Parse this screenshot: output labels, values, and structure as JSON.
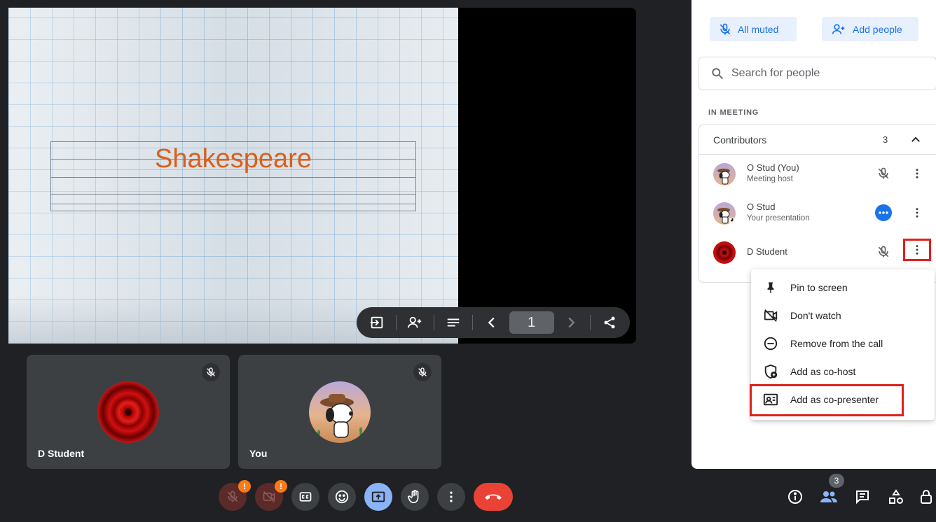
{
  "slide": {
    "title": "Shakespeare",
    "page": "1"
  },
  "tiles": [
    {
      "name": "D Student"
    },
    {
      "name": "You"
    }
  ],
  "panel": {
    "all_muted": "All muted",
    "add_people": "Add people",
    "search_placeholder": "Search for people",
    "section_label": "IN MEETING",
    "contributors_label": "Contributors",
    "contributors_count": "3",
    "people": [
      {
        "name": "O Stud (You)",
        "subtitle": "Meeting host"
      },
      {
        "name": "O Stud",
        "subtitle": "Your presentation"
      },
      {
        "name": "D Student",
        "subtitle": ""
      }
    ],
    "menu": [
      {
        "label": "Pin to screen",
        "icon": "pin-icon"
      },
      {
        "label": "Don't watch",
        "icon": "video-off-icon"
      },
      {
        "label": "Remove from the call",
        "icon": "remove-circle-icon"
      },
      {
        "label": "Add as co-host",
        "icon": "shield-add-icon"
      },
      {
        "label": "Add as co-presenter",
        "icon": "presenter-icon"
      }
    ]
  },
  "controls": {
    "warning_badge": "!",
    "people_count": "3"
  },
  "colors": {
    "accent": "#1a73e8",
    "end_call": "#ea4335",
    "highlight": "#e0201b",
    "slide_text": "#d9601a"
  }
}
